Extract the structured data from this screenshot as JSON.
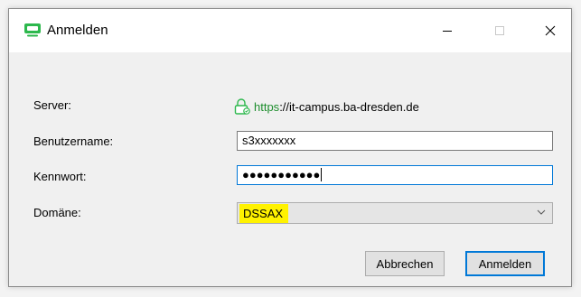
{
  "window": {
    "title": "Anmelden",
    "icon": "green-monitor-icon",
    "controls": [
      "minimize-icon",
      "maximize-icon",
      "close-icon"
    ]
  },
  "form": {
    "server": {
      "label": "Server:",
      "scheme": "https",
      "host": "://it-campus.ba-dresden.de",
      "icon": "lock-icon"
    },
    "username": {
      "label": "Benutzername:",
      "value": "s3xxxxxxx"
    },
    "password": {
      "label": "Kennwort:",
      "masked_value": "●●●●●●●●●●●"
    },
    "domain": {
      "label": "Domäne:",
      "selected": "DSSAX",
      "highlight_color": "#fff200"
    }
  },
  "buttons": {
    "cancel_label": "Abbrechen",
    "login_label": "Anmelden"
  },
  "colors": {
    "accent": "#0078d7",
    "secure_green": "#1e8e2e"
  }
}
